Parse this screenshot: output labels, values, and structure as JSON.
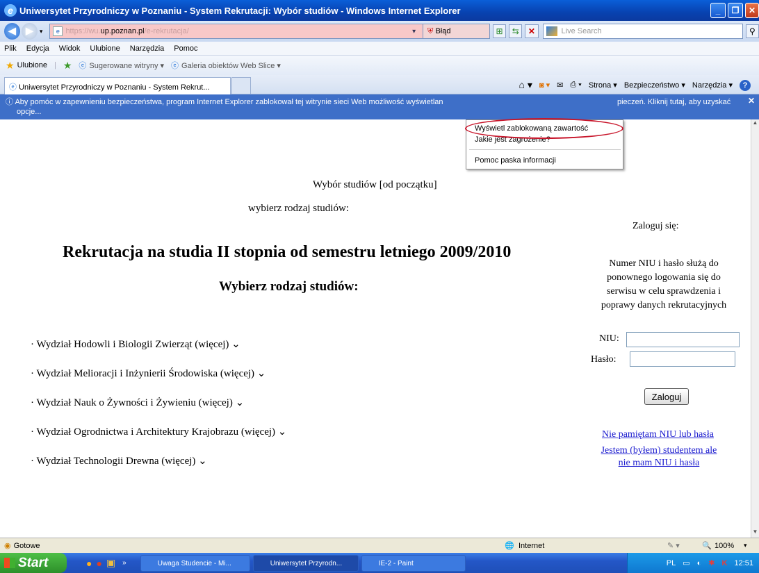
{
  "window": {
    "title": "Uniwersytet Przyrodniczy w Poznaniu - System Rekrutacji: Wybór studiów - Windows Internet Explorer"
  },
  "address_bar": {
    "url_prefix": "https://wu.",
    "url_domain": "up.poznan.pl",
    "url_suffix": "/e-rekrutacja/",
    "certificate_error": "Błąd certyfikatu",
    "search_placeholder": "Live Search"
  },
  "menu": [
    "Plik",
    "Edycja",
    "Widok",
    "Ulubione",
    "Narzędzia",
    "Pomoc"
  ],
  "favorites": {
    "label": "Ulubione",
    "items": [
      "Sugerowane witryny ▾",
      "Galeria obiektów Web Slice ▾"
    ]
  },
  "tab": {
    "title": "Uniwersytet Przyrodniczy w Poznaniu - System Rekrut..."
  },
  "command_bar": {
    "page": "Strona ▾",
    "safety": "Bezpieczeństwo ▾",
    "tools": "Narzędzia ▾"
  },
  "info_bar": {
    "text_start": "Aby pomóc w zapewnieniu bezpieczeństwa, program Internet Explorer zablokował tej witrynie sieci Web możliwość wyświetlan",
    "text_end": "pieczeń. Kliknij tutaj, aby uzyskać",
    "text_line2": "opcje..."
  },
  "context_menu": {
    "items": [
      "Wyświetl zablokowaną zawartość",
      "Jakie jest zagrożenie?",
      "Pomoc paska informacji"
    ]
  },
  "page": {
    "top_title": "Wybór studiów [od początku]",
    "top_subtitle": "wybierz rodzaj studiów:",
    "heading": "Rekrutacja na studia II stopnia od semestru letniego 2009/2010",
    "subheading": "Wybierz rodzaj studiów:",
    "faculties": [
      "· Wydział Hodowli i Biologii Zwierząt (więcej) ⌄",
      "· Wydział Melioracji i Inżynierii Środowiska (więcej) ⌄",
      "· Wydział Nauk o Żywności i Żywieniu (więcej) ⌄",
      "· Wydział Ogrodnictwa i Architektury Krajobrazu (więcej) ⌄",
      "· Wydział Technologii Drewna (więcej) ⌄"
    ]
  },
  "login": {
    "title": "Zaloguj się:",
    "info_lines": [
      "Numer NIU i hasło służą do",
      "ponownego logowania się do",
      "serwisu w celu sprawdzenia i",
      "poprawy danych rekrutacyjnych"
    ],
    "niu_label": "NIU:",
    "password_label": "Hasło:",
    "niu_value": "",
    "password_value": "",
    "button": "Zaloguj",
    "forgot_link": "Nie pamiętam NIU lub hasła",
    "student_link_1": "Jestem (byłem) studentem ale",
    "student_link_2": "nie mam NIU i hasła"
  },
  "status_bar": {
    "status": "Gotowe",
    "zone": "Internet",
    "zoom": "100%"
  },
  "taskbar": {
    "start": "Start",
    "tasks": [
      "Uwaga Studencie - Mi...",
      "Uniwersytet Przyrodn...",
      "IE-2 - Paint"
    ],
    "language": "PL",
    "clock": "12:51"
  }
}
